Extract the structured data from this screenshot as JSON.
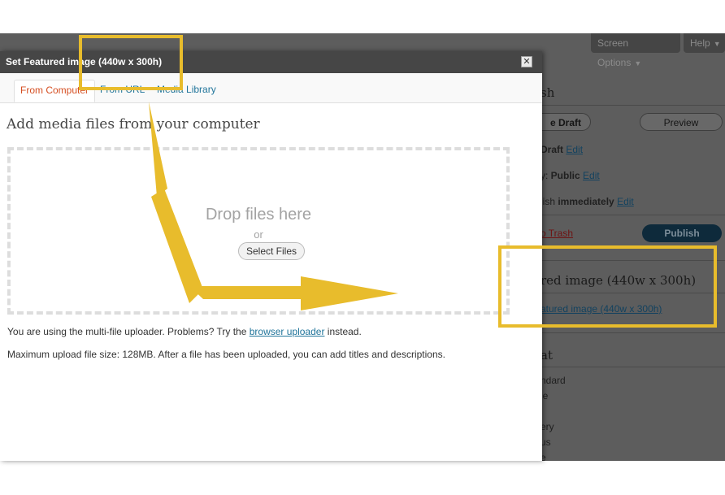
{
  "admin": {
    "screen_options_label": "Screen Options",
    "help_label": "Help",
    "publish_box": {
      "title_fragment": "sh",
      "save_draft_label": "e Draft",
      "preview_label": "Preview",
      "status_label": "Draft",
      "visibility_prefix": "y: ",
      "visibility_value": "Public",
      "schedule_prefix": "lish ",
      "schedule_value": "immediately",
      "edit_label": "Edit",
      "trash_label": "o Trash",
      "publish_label": "Publish"
    },
    "featured_box": {
      "title": "red image (440w x 300h)",
      "link_text": "atured image (440w x 300h)"
    },
    "format_box": {
      "title_fragment": "at",
      "options": [
        "ndard",
        "le",
        "ery",
        "us",
        "e"
      ]
    }
  },
  "modal": {
    "title": "Set Featured image (440w x 300h)",
    "close_glyph": "✕",
    "tabs": [
      {
        "label": "From Computer",
        "active": true
      },
      {
        "label": "From URL",
        "active": false
      },
      {
        "label": "Media Library",
        "active": false
      }
    ],
    "heading": "Add media files from your computer",
    "drop_text": "Drop files here",
    "or_text": "or",
    "select_files_label": "Select Files",
    "uploader_prefix": "You are using the multi-file uploader. Problems? Try the ",
    "uploader_link": "browser uploader",
    "uploader_suffix": " instead.",
    "max_size_text": "Maximum upload file size: 128MB. After a file has been uploaded, you can add titles and descriptions."
  },
  "annotation": {
    "accent_color": "#e8bc2c",
    "arrow_icon": "bent-arrow-icon"
  }
}
